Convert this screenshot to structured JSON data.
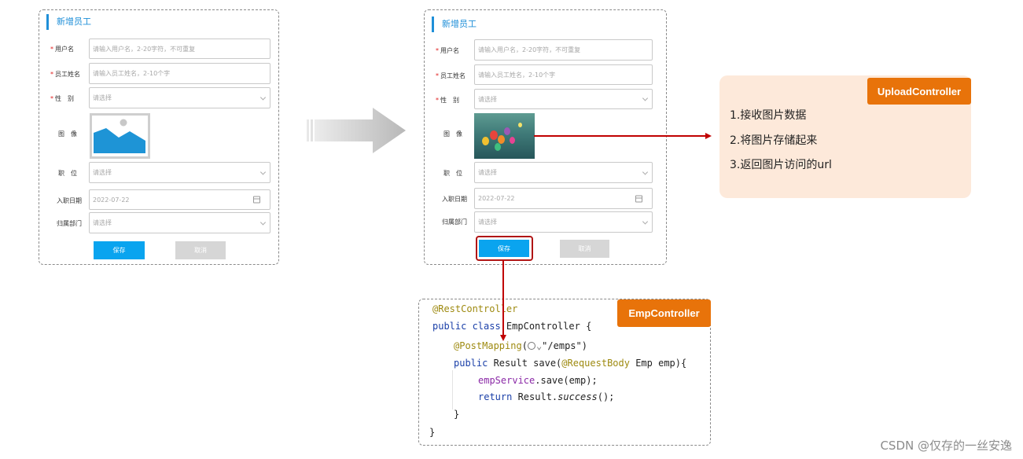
{
  "forms": [
    {
      "title": "新增员工",
      "fields": {
        "username": {
          "label": "用户名",
          "placeholder": "请输入用户名，2-20字符，不可重复"
        },
        "name": {
          "label": "员工姓名",
          "placeholder": "请输入员工姓名，2-10个字"
        },
        "gender": {
          "label": "性　别",
          "placeholder": "请选择"
        },
        "image": {
          "label": "图　像"
        },
        "job": {
          "label": "职　位",
          "placeholder": "请选择"
        },
        "entry_date": {
          "label": "入职日期",
          "value": "2022-07-22"
        },
        "dept": {
          "label": "归属部门",
          "placeholder": "请选择"
        }
      },
      "buttons": {
        "save": "保存",
        "cancel": "取消"
      }
    },
    {
      "title": "新增员工",
      "fields": {
        "username": {
          "label": "用户名",
          "placeholder": "请输入用户名，2-20字符，不可重复"
        },
        "name": {
          "label": "员工姓名",
          "placeholder": "请输入员工姓名，2-10个字"
        },
        "gender": {
          "label": "性　别",
          "placeholder": "请选择"
        },
        "image": {
          "label": "图　像"
        },
        "job": {
          "label": "职　位",
          "placeholder": "请选择"
        },
        "entry_date": {
          "label": "入职日期",
          "value": "2022-07-22"
        },
        "dept": {
          "label": "归属部门",
          "placeholder": "请选择"
        }
      },
      "buttons": {
        "save": "保存",
        "cancel": "取消"
      }
    }
  ],
  "upload_controller": {
    "tag": "UploadController",
    "steps": [
      "1.接收图片数据",
      "2.将图片存储起来",
      "3.返回图片访问的url"
    ]
  },
  "emp_controller": {
    "tag": "EmpController",
    "code": {
      "l1": "@RestController",
      "l2_kw": "public class ",
      "l2_rest": "EmpController {",
      "l3_ann": "@PostMapping",
      "l3_paren": "(",
      "l3_str": "\"/emps\")",
      "l4_kw": "public ",
      "l4_a": "Result ",
      "l4_b": "save(",
      "l4_ann": "@RequestBody ",
      "l4_c": "Emp emp){",
      "l5_fld": "empService",
      "l5_rest": ".save(emp);",
      "l6_kw": "return ",
      "l6_a": "Result.",
      "l6_it": "success",
      "l6_b": "();",
      "l7": "}",
      "l8": "}"
    }
  },
  "watermark": "CSDN @仅存的一丝安逸",
  "colors": {
    "accent_blue": "#0aa4ef",
    "tag_orange": "#e8730a",
    "arrow_red": "#c00000",
    "note_bg": "#fde9da"
  }
}
